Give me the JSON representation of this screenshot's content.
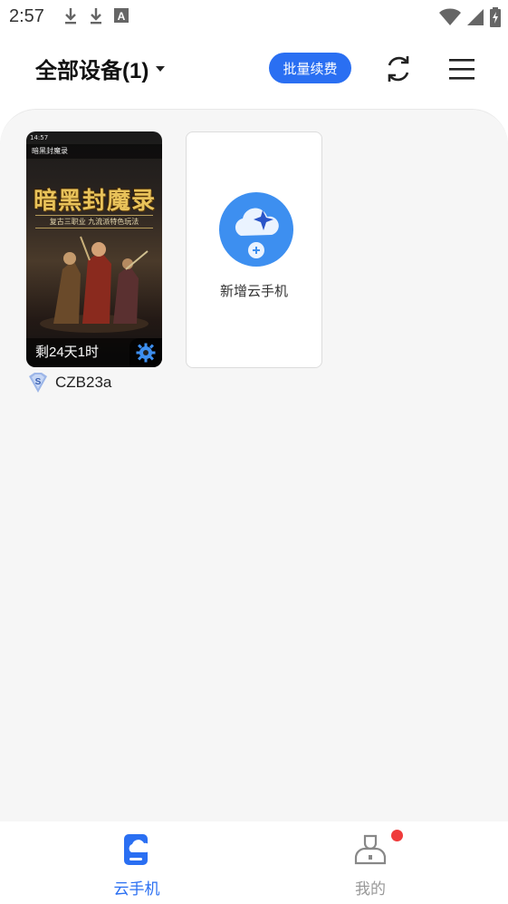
{
  "status_bar": {
    "time": "2:57",
    "left_icons": [
      "download-icon",
      "download-icon",
      "font-icon"
    ],
    "right_icons": [
      "wifi-icon",
      "signal-icon",
      "battery-charging-icon"
    ]
  },
  "header": {
    "filter_label": "全部设备(1)",
    "renew_label": "批量续费",
    "refresh_icon": "refresh-icon",
    "menu_icon": "menu-icon",
    "accent_color": "#2a6ff2"
  },
  "devices": [
    {
      "screen": {
        "mini_time": "14:57",
        "app_title": "暗黑封魔录",
        "game_title": "暗黑封魔录",
        "game_subtitle": "复古三职业 九流派特色玩法"
      },
      "remaining": "剩24天1时",
      "settings_icon": "gear-icon",
      "vip_icon": "vip-s-badge-icon",
      "name": "CZB23a"
    }
  ],
  "add_card": {
    "icon": "cloud-add-icon",
    "label": "新增云手机"
  },
  "bottom_nav": {
    "items": [
      {
        "label": "云手机",
        "icon": "cloud-phone-icon",
        "active": true
      },
      {
        "label": "我的",
        "icon": "profile-icon",
        "active": false,
        "badge": "red-dot"
      }
    ]
  }
}
